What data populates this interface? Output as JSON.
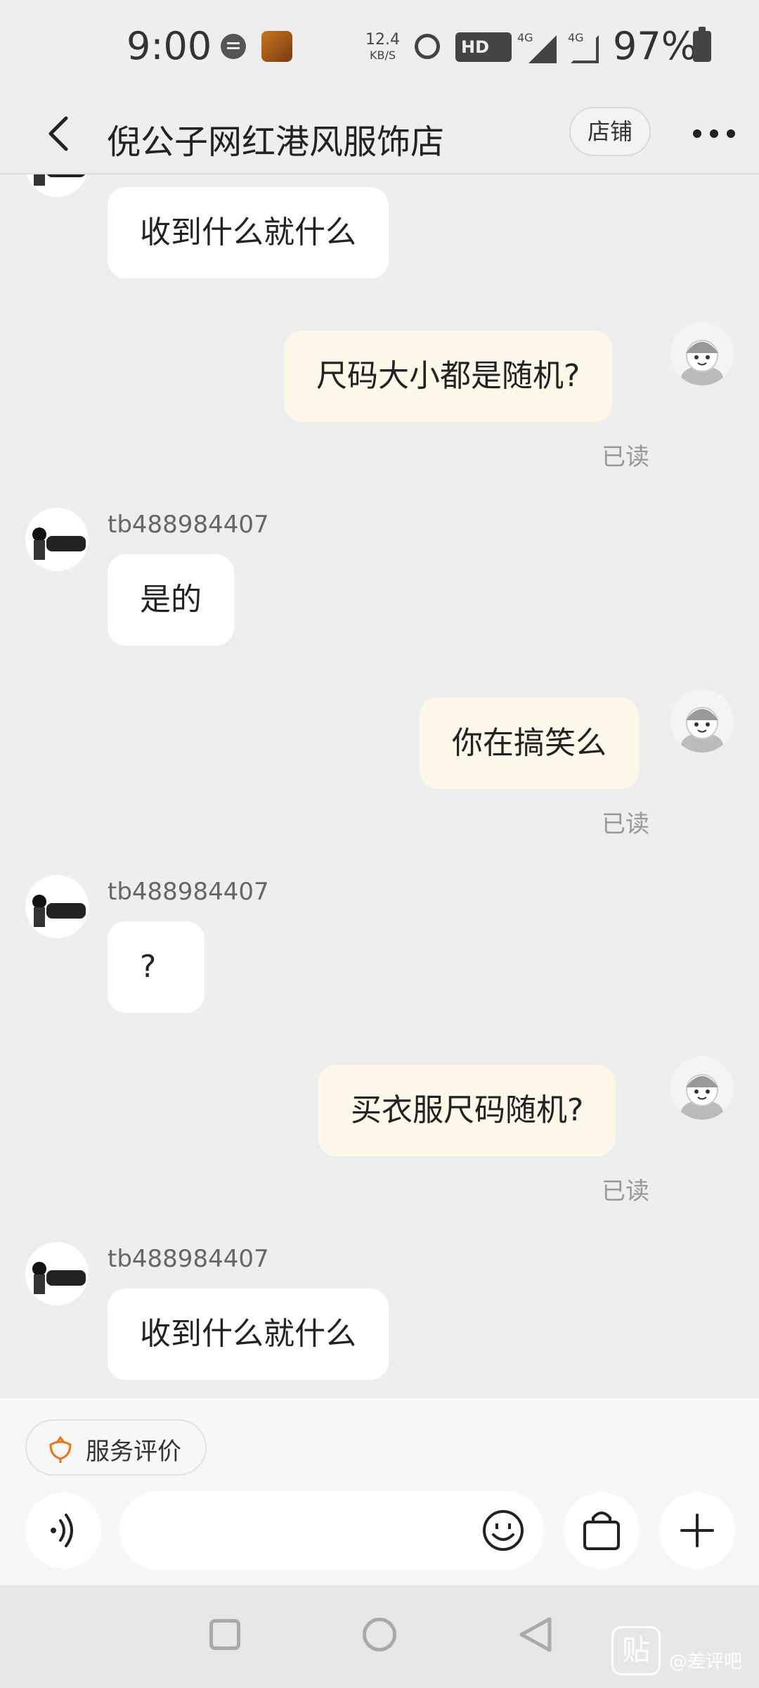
{
  "status_bar": {
    "time": "9:00",
    "speed_value": "12.4",
    "speed_unit": "KB/S",
    "hd": "HD",
    "net1": "4G",
    "net2": "4G",
    "battery": "97%",
    "icons": [
      "message-icon",
      "app-thumbnail-icon",
      "alarm-icon",
      "hd-icon",
      "signal-icon",
      "battery-icon"
    ]
  },
  "header": {
    "title": "倪公子网红港风服饰店",
    "store_label": "店铺",
    "icons": [
      "back-icon",
      "more-icon"
    ]
  },
  "messages": [
    {
      "side": "in",
      "text": "收到什么就什么"
    },
    {
      "side": "out",
      "text": "尺码大小都是随机?",
      "read": "已读"
    },
    {
      "side": "in",
      "sender": "tb488984407",
      "text": "是的"
    },
    {
      "side": "out",
      "text": "你在搞笑么",
      "read": "已读"
    },
    {
      "side": "in",
      "sender": "tb488984407",
      "text": "?"
    },
    {
      "side": "out",
      "text": "买衣服尺码随机?",
      "read": "已读"
    },
    {
      "side": "in",
      "sender": "tb488984407",
      "text": "收到什么就什么"
    }
  ],
  "bottom": {
    "service_rating_label": "服务评价",
    "input_placeholder": "",
    "icons": [
      "voice-icon",
      "emoji-icon",
      "shopping-bag-icon",
      "plus-icon"
    ]
  },
  "navbar": {
    "icons": [
      "recent-apps-icon",
      "home-icon",
      "back-nav-icon"
    ]
  },
  "watermark": {
    "logo_char": "贴",
    "text": "@差评吧"
  },
  "colors": {
    "background": "#eeeeee",
    "incoming_bubble": "#ffffff",
    "outgoing_bubble": "#fdf8ea",
    "accent_orange": "#e8731e"
  }
}
